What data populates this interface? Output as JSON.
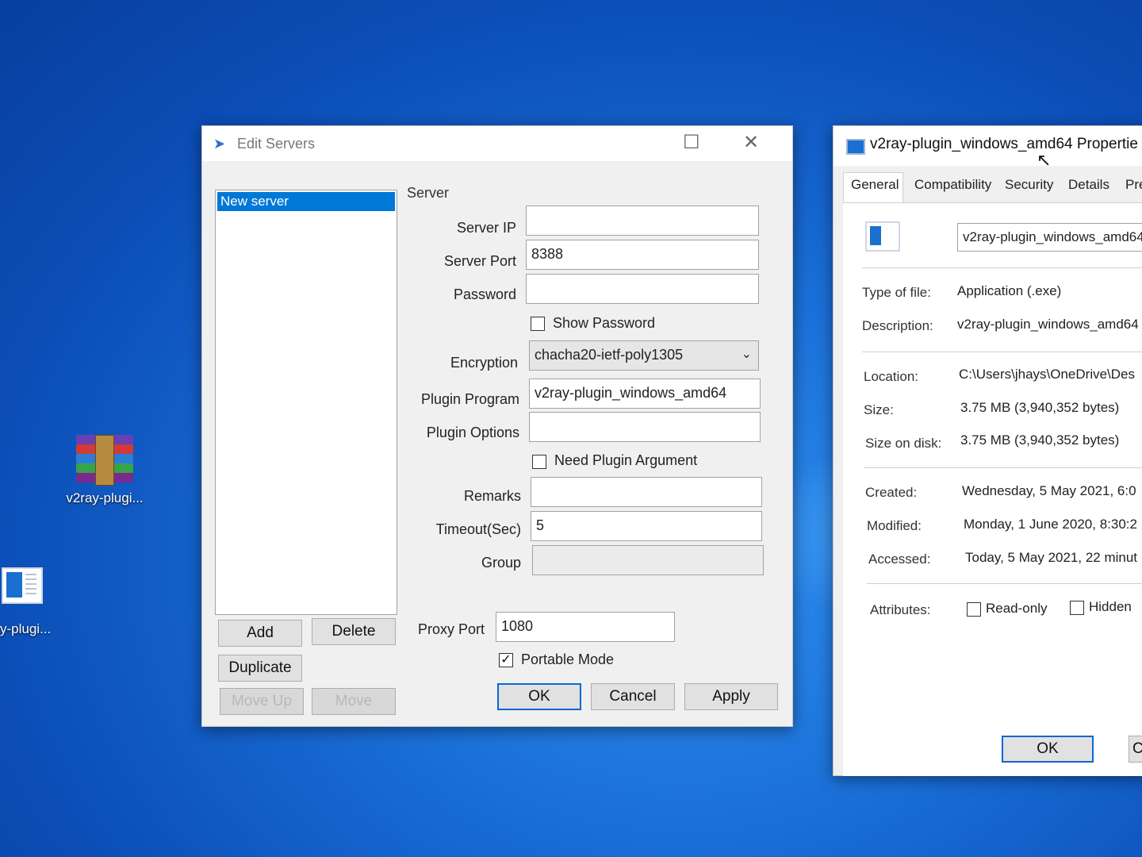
{
  "desktop": {
    "icon1_label": "v2ray-plugi...",
    "icon2_label": "y-plugi..."
  },
  "edit_servers": {
    "title": "Edit Servers",
    "server_list": [
      "New server"
    ],
    "group_label": "Server",
    "server_ip_label": "Server IP",
    "server_ip_value": "",
    "server_port_label": "Server Port",
    "server_port_value": "8388",
    "password_label": "Password",
    "password_value": "",
    "show_password_label": "Show Password",
    "encryption_label": "Encryption",
    "encryption_value": "chacha20-ietf-poly1305",
    "plugin_program_label": "Plugin Program",
    "plugin_program_value": "v2ray-plugin_windows_amd64",
    "plugin_options_label": "Plugin Options",
    "plugin_options_value": "",
    "need_plugin_arg_label": "Need Plugin Argument",
    "remarks_label": "Remarks",
    "remarks_value": "",
    "timeout_label": "Timeout(Sec)",
    "timeout_value": "5",
    "group_field_label": "Group",
    "group_value": "",
    "add_label": "Add",
    "delete_label": "Delete",
    "duplicate_label": "Duplicate",
    "move_up_label": "Move Up",
    "move_down_label": "Move",
    "proxy_port_label": "Proxy Port",
    "proxy_port_value": "1080",
    "portable_mode_label": "Portable Mode",
    "portable_mode_checked": true,
    "ok_label": "OK",
    "cancel_label": "Cancel",
    "apply_label": "Apply"
  },
  "properties": {
    "title": "v2ray-plugin_windows_amd64 Propertie",
    "tabs": [
      "General",
      "Compatibility",
      "Security",
      "Details",
      "Pre"
    ],
    "file_name": "v2ray-plugin_windows_amd64",
    "type_label": "Type of file:",
    "type_value": "Application (.exe)",
    "desc_label": "Description:",
    "desc_value": "v2ray-plugin_windows_amd64",
    "location_label": "Location:",
    "location_value": "C:\\Users\\jhays\\OneDrive\\Des",
    "size_label": "Size:",
    "size_value": "3.75 MB (3,940,352 bytes)",
    "size_disk_label": "Size on disk:",
    "size_disk_value": "3.75 MB (3,940,352 bytes)",
    "created_label": "Created:",
    "created_value": "Wednesday, 5 May 2021, 6:0",
    "modified_label": "Modified:",
    "modified_value": "Monday, 1 June 2020, 8:30:2",
    "accessed_label": "Accessed:",
    "accessed_value": "Today, 5 May 2021, 22 minut",
    "attributes_label": "Attributes:",
    "readonly_label": "Read-only",
    "hidden_label": "Hidden",
    "ok_label": "OK",
    "cancel_label": "Ca"
  }
}
